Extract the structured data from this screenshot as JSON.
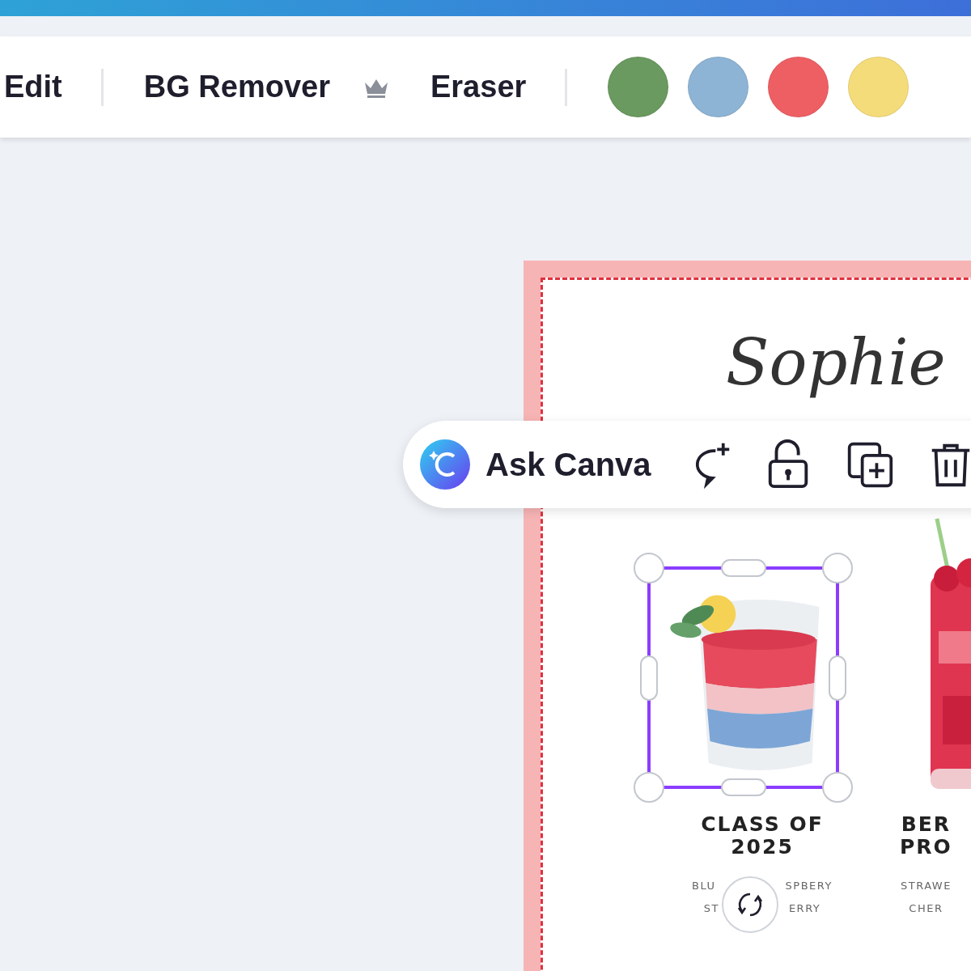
{
  "toolbar": {
    "buttons": [
      {
        "kind": "button",
        "label": "Edit",
        "premium": false
      },
      {
        "kind": "divider"
      },
      {
        "kind": "button",
        "label": "BG Remover",
        "premium": true
      },
      {
        "kind": "button",
        "label": "Eraser",
        "premium": false
      },
      {
        "kind": "divider"
      }
    ],
    "swatches": [
      {
        "color": "#6a9a5f"
      },
      {
        "color": "#8db4d4"
      },
      {
        "color": "#ee5f64"
      },
      {
        "color": "#f5dc7a"
      }
    ]
  },
  "design": {
    "script_name": "Sophie",
    "drinks": [
      {
        "kind": "layered",
        "selected": true,
        "title_lines": [
          "CLASS OF",
          "2025"
        ],
        "detail_lines": [
          [
            "BLU",
            "SPBERY"
          ],
          [
            "ST",
            "ERRY"
          ]
        ]
      },
      {
        "kind": "berry",
        "selected": false,
        "title_lines": [
          "BER",
          "PRO"
        ],
        "detail_lines": [
          [
            "STRAWE"
          ],
          [
            "CHER"
          ]
        ]
      }
    ]
  },
  "ask_bar": {
    "label": "Ask Canva"
  }
}
